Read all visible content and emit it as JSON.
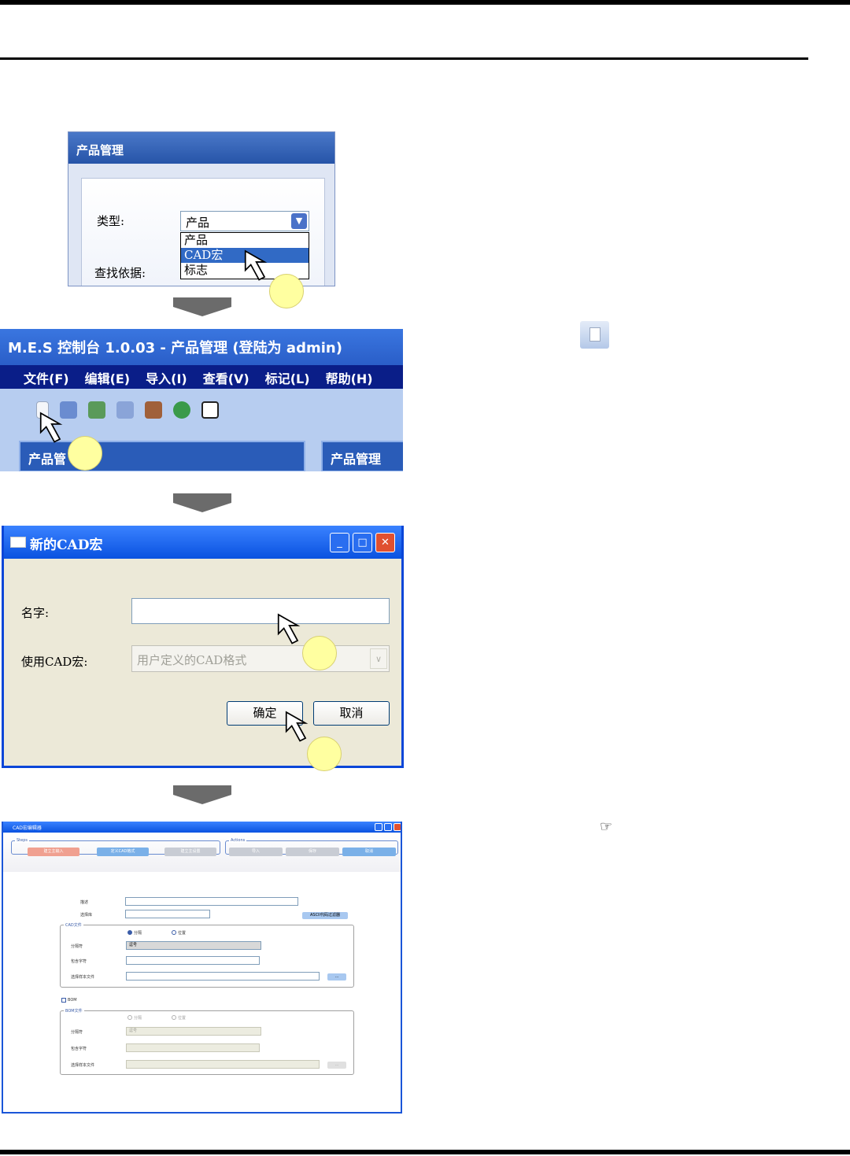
{
  "panel1": {
    "title": "产品管理",
    "type_label": "类型:",
    "type_value": "产品",
    "options": [
      "产品",
      "CAD宏",
      "标志"
    ],
    "selected_option": "CAD宏",
    "search_label": "查找依据:"
  },
  "panel2": {
    "title": "M.E.S 控制台 1.0.03 - 产品管理 (登陆为 admin)",
    "menu": [
      "文件(F)",
      "编辑(E)",
      "导入(I)",
      "查看(V)",
      "标记(L)",
      "帮助(H)"
    ],
    "left_panel_title": "产品管",
    "right_panel_title": "产品管理",
    "toolbar_icons": [
      "new-icon",
      "open-folder-icon",
      "cad-icon",
      "edit-icon",
      "exit-door-icon",
      "refresh-icon",
      "help-icon"
    ]
  },
  "panel3": {
    "title": "新的CAD宏",
    "name_label": "名字:",
    "name_value": "",
    "use_macro_label": "使用CAD宏:",
    "use_macro_value": "用户定义的CAD格式",
    "ok_label": "确定",
    "cancel_label": "取消"
  },
  "panel4": {
    "title": "CAD宏编辑器",
    "steps_label": "Steps",
    "actions_label": "Actions",
    "steps": [
      "建立主输入",
      "定义CAD格式",
      "建立主设置"
    ],
    "actions": [
      "导入",
      "保存",
      "取消"
    ],
    "desc_label": "描述",
    "lib_label": "选择库",
    "ascii_filter_label": "ASCII代码过滤器",
    "cad_file_group": "CAD文件",
    "radio_split": "分隔",
    "radio_position": "位置",
    "separator_label": "分隔符",
    "separator_value": "逗号",
    "contains_label": "包含字符",
    "sample_label": "选择样本文件",
    "browse_label": "...",
    "bom_label": "BOM",
    "bom_group": "BOM文件",
    "bom_separator_value": "逗号"
  },
  "colors": {
    "xp_blue": "#0a52e0",
    "marker": "#ffffa0",
    "step_active": "#f0a090",
    "step_blue": "#7ab0e8"
  }
}
